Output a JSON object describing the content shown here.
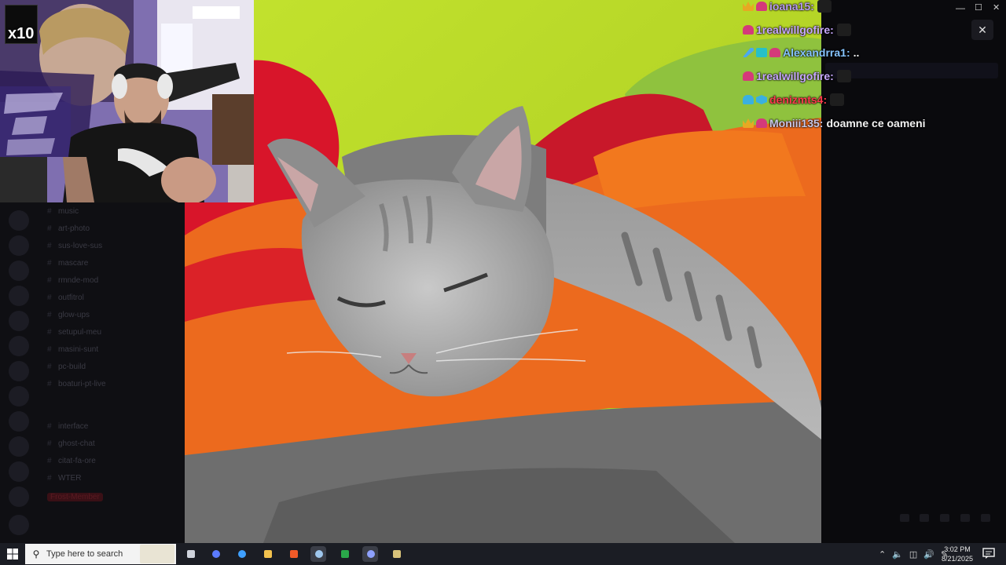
{
  "chat": {
    "messages": [
      {
        "user": "ioana15",
        "user_color": "#b89cf0",
        "badges": [
          "crown",
          "ghost"
        ],
        "text": "",
        "emote": true
      },
      {
        "user": "1realwillgofire",
        "user_color": "#c8a9ff",
        "badges": [
          "ghost"
        ],
        "text": "",
        "emote": true
      },
      {
        "user": "Alexandrra1",
        "user_color": "#86c4ff",
        "badges": [
          "sword",
          "grid",
          "ghost"
        ],
        "text": "..",
        "emote": false
      },
      {
        "user": "1realwillgofire",
        "user_color": "#c8a9ff",
        "badges": [
          "ghost"
        ],
        "text": "",
        "emote": true
      },
      {
        "user": "denizmts4",
        "user_color": "#ff3b4e",
        "badges": [
          "ghost2",
          "cube"
        ],
        "text": "",
        "emote": true
      },
      {
        "user": "Moniii135",
        "user_color": "#c8c8e8",
        "badges": [
          "crown",
          "ghost"
        ],
        "text": "doamne ce oameni",
        "emote": false
      }
    ]
  },
  "webcam": {
    "multiplier_badge": "x10"
  },
  "sidebar": {
    "channels": [
      "music",
      "art-photo",
      "sus-love-sus",
      "mascare",
      "rmnde-mod",
      "outfitrol",
      "glow-ups",
      "setupul-meu",
      "masini-sunt",
      "pc-build",
      "boaturi-pt-live",
      "interface",
      "ghost-chat",
      "citat-fa-ore",
      "WTER",
      "Frost-Member"
    ]
  },
  "taskbar": {
    "search_placeholder": "Type here to search",
    "time": "3:02 PM",
    "date": "8/21/2025",
    "apps": [
      {
        "name": "task-view",
        "color": "#cfd3dc"
      },
      {
        "name": "copilot",
        "color": "#5b7bff"
      },
      {
        "name": "copilot-app",
        "color": "#3fa0ff"
      },
      {
        "name": "file-explorer",
        "color": "#f2c14e"
      },
      {
        "name": "brave",
        "color": "#f05a28"
      },
      {
        "name": "steam",
        "color": "#9fc7ee"
      },
      {
        "name": "xbox-app",
        "color": "#2aa84a"
      },
      {
        "name": "discord",
        "color": "#8ea1ff"
      },
      {
        "name": "other-app",
        "color": "#d8c27a"
      }
    ]
  },
  "window": {
    "minimize": "—",
    "maximize": "☐",
    "close": "✕",
    "overlay_close": "✕"
  }
}
